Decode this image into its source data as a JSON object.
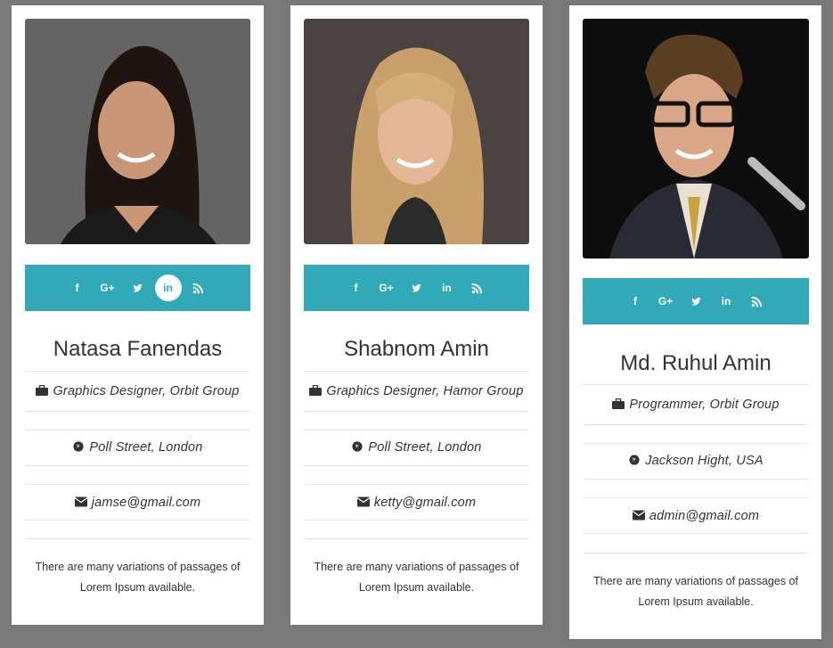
{
  "cards": [
    {
      "name": "Natasa Fanendas",
      "role": "Graphics Designer, Orbit Group",
      "location": "Poll Street, London",
      "email": "jamse@gmail.com",
      "description": "There are many variations of passages of Lorem Ipsum available.",
      "active_social": "linkedin"
    },
    {
      "name": "Shabnom Amin",
      "role": "Graphics Designer, Hamor Group",
      "location": "Poll Street, London",
      "email": "ketty@gmail.com",
      "description": "There are many variations of passages of Lorem Ipsum available.",
      "active_social": ""
    },
    {
      "name": "Md. Ruhul Amin",
      "role": "Programmer, Orbit Group",
      "location": "Jackson Hight, USA",
      "email": "admin@gmail.com",
      "description": "There are many variations of passages of Lorem Ipsum available.",
      "active_social": ""
    }
  ],
  "social_icons": [
    "facebook-icon",
    "google-plus-icon",
    "twitter-icon",
    "linkedin-icon",
    "rss-icon"
  ],
  "colors": {
    "background": "#797979",
    "card": "#ffffff",
    "accent": "#32a9b9",
    "text": "#333333"
  }
}
